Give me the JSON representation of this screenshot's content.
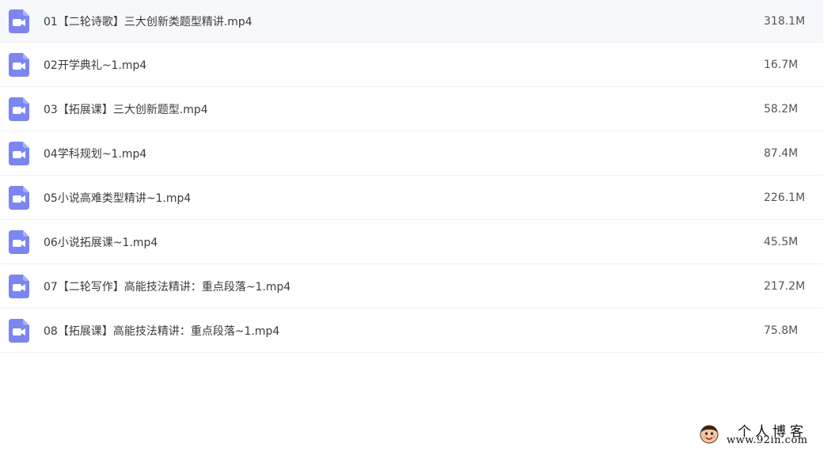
{
  "colors": {
    "icon_bg": "#7b86f0",
    "divider": "#eef0f3",
    "text": "#3b3b3b"
  },
  "files": [
    {
      "name": "01【二轮诗歌】三大创新类题型精讲.mp4",
      "size": "318.1M",
      "icon": "video-file-icon"
    },
    {
      "name": "02开学典礼~1.mp4",
      "size": "16.7M",
      "icon": "video-file-icon"
    },
    {
      "name": "03【拓展课】三大创新题型.mp4",
      "size": "58.2M",
      "icon": "video-file-icon"
    },
    {
      "name": "04学科规划~1.mp4",
      "size": "87.4M",
      "icon": "video-file-icon"
    },
    {
      "name": "05小说高难类型精讲~1.mp4",
      "size": "226.1M",
      "icon": "video-file-icon"
    },
    {
      "name": "06小说拓展课~1.mp4",
      "size": "45.5M",
      "icon": "video-file-icon"
    },
    {
      "name": "07【二轮写作】高能技法精讲：重点段落~1.mp4",
      "size": "217.2M",
      "icon": "video-file-icon"
    },
    {
      "name": "08【拓展课】高能技法精讲：重点段落~1.mp4",
      "size": "75.8M",
      "icon": "video-file-icon"
    }
  ],
  "watermark": {
    "title": "个人博客",
    "url": "www.92in.com",
    "avatar_icon": "cartoon-avatar-icon"
  }
}
